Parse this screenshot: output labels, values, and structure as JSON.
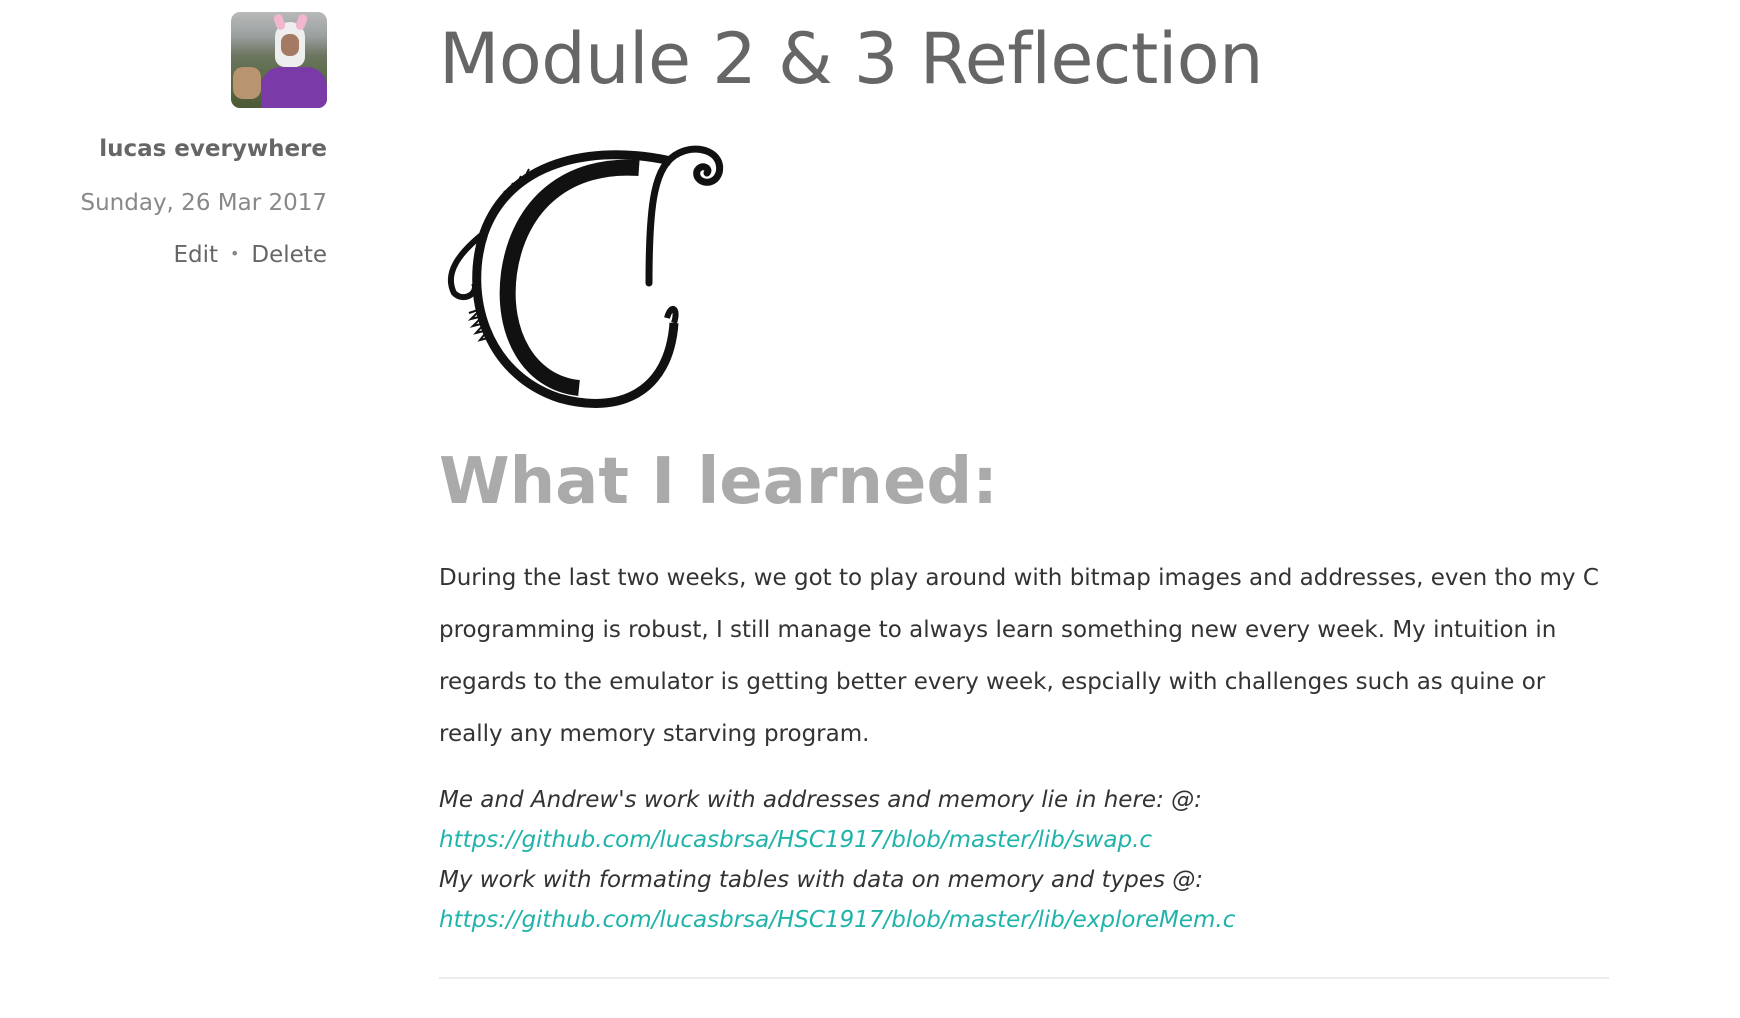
{
  "sidebar": {
    "author": "lucas everywhere",
    "date": "Sunday, 26 Mar 2017",
    "edit_label": "Edit",
    "separator": "•",
    "delete_label": "Delete"
  },
  "post": {
    "title": "Module 2 & 3 Reflection",
    "heading": "What I learned:",
    "paragraph": "During the last two weeks, we got to play around with bitmap images and addresses, even tho my C programming is robust, I still manage to always learn something new every week. My intuition in regards to the emulator is getting better every week, espcially with challenges such as quine or really any memory starving program.",
    "links": [
      {
        "text": "Me and Andrew's work with addresses and memory lie in here: @: ",
        "url": "https://github.com/lucasbrsa/HSC1917/blob/master/lib/swap.c"
      },
      {
        "text": "My work with formating tables with data on memory and types @: ",
        "url": "https://github.com/lucasbrsa/HSC1917/blob/master/lib/exploreMem.c"
      }
    ]
  },
  "colors": {
    "link": "#1fb3aa",
    "heading": "#aaaaaa",
    "title": "#666666"
  }
}
